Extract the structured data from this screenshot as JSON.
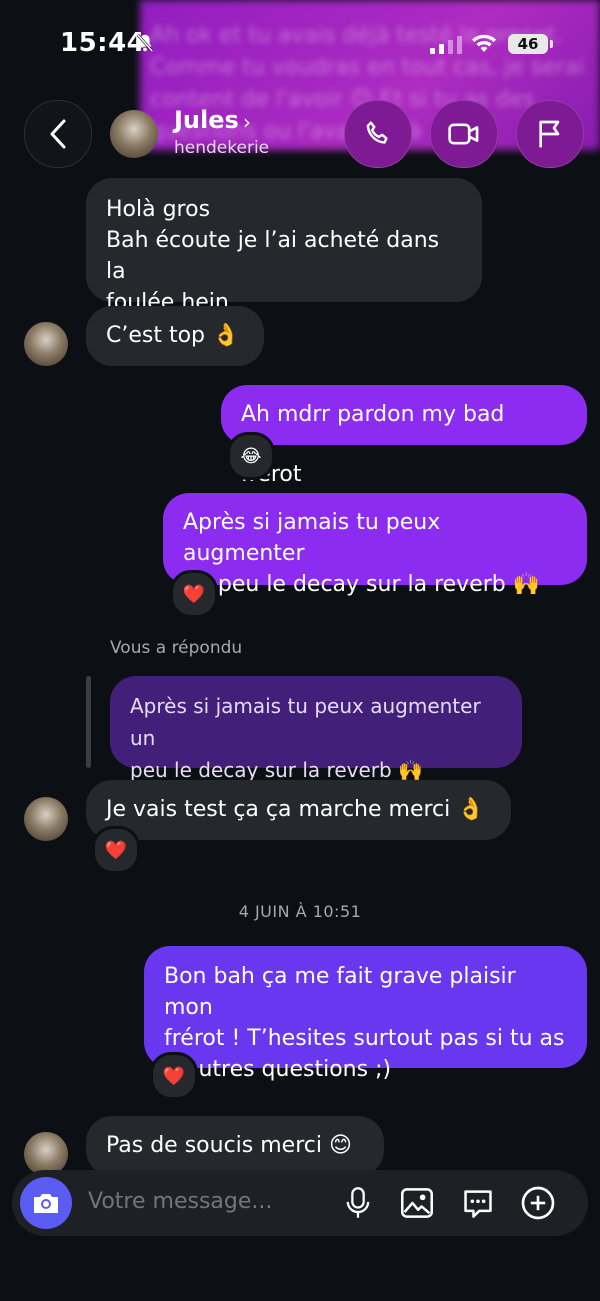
{
  "status": {
    "time": "15:44",
    "battery": "46"
  },
  "header": {
    "name": "Jules",
    "chevron": "›",
    "username": "hendekerie"
  },
  "blurred_preview": {
    "text": "Ah ok et tu avais déjà testé le preset. Comme tu voudras en tout cas, je serai content de l'avoir 😊 Et si tu as des questions ou l'avais déjà"
  },
  "messages": {
    "m1_l1": "Holà gros",
    "m1_l2": "Bah écoute je l’ai acheté dans la",
    "m1_l3": "foulée hein",
    "m2": "C’est top 👌",
    "m3": "Ah mdrr pardon my bad frérot",
    "m3_reaction": "😂",
    "m4_l1": "Après si jamais tu peux augmenter",
    "m4_l2": "un peu le decay sur la reverb 🙌",
    "m4_reaction": "❤️",
    "reply_label": "Vous a répondu",
    "reply_l1": "Après si jamais tu peux augmenter un",
    "reply_l2": "peu le decay sur la reverb 🙌",
    "m5": "Je vais test ça ça marche merci 👌",
    "m5_reaction": "❤️",
    "date": "4 JUIN À 10:51",
    "m6_l1": "Bon bah ça me fait grave plaisir mon",
    "m6_l2": "frérot ! T’hesites surtout pas si tu as",
    "m6_l3": "d’autres questions ;)",
    "m6_reaction": "❤️",
    "m7": "Pas de soucis merci 😊"
  },
  "composer": {
    "placeholder": "Votre message..."
  },
  "icons": [
    "bell-slash-icon",
    "signal-icon",
    "wifi-icon",
    "battery-icon",
    "back-icon",
    "phone-icon",
    "video-icon",
    "flag-icon",
    "camera-icon",
    "microphone-icon",
    "image-icon",
    "sticker-icon",
    "plus-icon"
  ],
  "colors": {
    "outgoing": "#8b2cf0",
    "outgoing_alt": "#6a37f0",
    "incoming": "#25282d",
    "reply": "#42207a",
    "background": "#0c0f13"
  }
}
